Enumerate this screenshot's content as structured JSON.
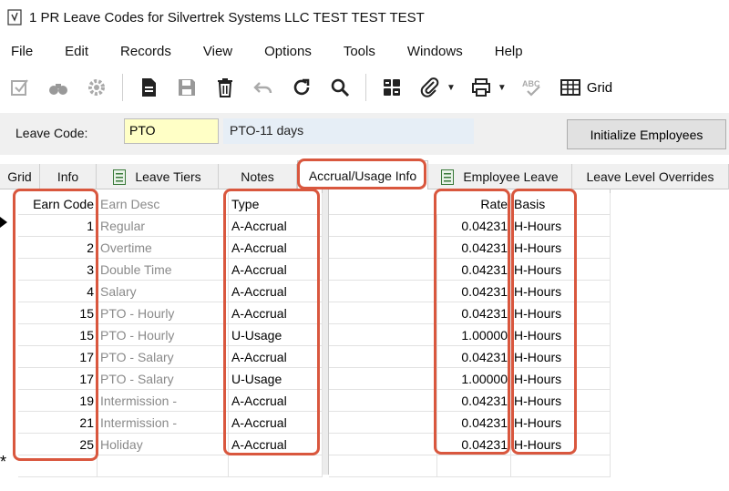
{
  "window": {
    "title": "1 PR Leave Codes for Silvertrek Systems LLC TEST TEST TEST"
  },
  "menu": [
    "File",
    "Edit",
    "Records",
    "View",
    "Options",
    "Tools",
    "Windows",
    "Help"
  ],
  "toolbar": {
    "grid_label": "Grid"
  },
  "leave": {
    "label": "Leave Code:",
    "code": "PTO",
    "description": "PTO-11 days",
    "initialize_button": "Initialize Employees"
  },
  "tabs": [
    "Grid",
    "Info",
    "Leave Tiers",
    "Notes",
    "Accrual/Usage Info",
    "Employee Leave",
    "Leave Level Overrides"
  ],
  "active_tab": "Accrual/Usage Info",
  "grid": {
    "columns": {
      "earn_code": "Earn Code",
      "earn_desc": "Earn Desc",
      "type": "Type",
      "rate": "Rate",
      "basis": "Basis"
    },
    "rows": [
      {
        "earn_code": "1",
        "earn_desc": "Regular",
        "type": "A-Accrual",
        "rate": "0.04231",
        "basis": "H-Hours"
      },
      {
        "earn_code": "2",
        "earn_desc": "Overtime",
        "type": "A-Accrual",
        "rate": "0.04231",
        "basis": "H-Hours"
      },
      {
        "earn_code": "3",
        "earn_desc": "Double Time",
        "type": "A-Accrual",
        "rate": "0.04231",
        "basis": "H-Hours"
      },
      {
        "earn_code": "4",
        "earn_desc": "Salary",
        "type": "A-Accrual",
        "rate": "0.04231",
        "basis": "H-Hours"
      },
      {
        "earn_code": "15",
        "earn_desc": "PTO - Hourly",
        "type": "A-Accrual",
        "rate": "0.04231",
        "basis": "H-Hours"
      },
      {
        "earn_code": "15",
        "earn_desc": "PTO - Hourly",
        "type": "U-Usage",
        "rate": "1.00000",
        "basis": "H-Hours"
      },
      {
        "earn_code": "17",
        "earn_desc": "PTO - Salary",
        "type": "A-Accrual",
        "rate": "0.04231",
        "basis": "H-Hours"
      },
      {
        "earn_code": "17",
        "earn_desc": "PTO - Salary",
        "type": "U-Usage",
        "rate": "1.00000",
        "basis": "H-Hours"
      },
      {
        "earn_code": "19",
        "earn_desc": "Intermission -",
        "type": "A-Accrual",
        "rate": "0.04231",
        "basis": "H-Hours"
      },
      {
        "earn_code": "21",
        "earn_desc": "Intermission -",
        "type": "A-Accrual",
        "rate": "0.04231",
        "basis": "H-Hours"
      },
      {
        "earn_code": "25",
        "earn_desc": "Holiday",
        "type": "A-Accrual",
        "rate": "0.04231",
        "basis": "H-Hours"
      }
    ],
    "new_row_marker": "*"
  },
  "colors": {
    "highlight": "#d9573e",
    "code_field": "#ffffc6",
    "desc_field": "#e6eef6"
  }
}
